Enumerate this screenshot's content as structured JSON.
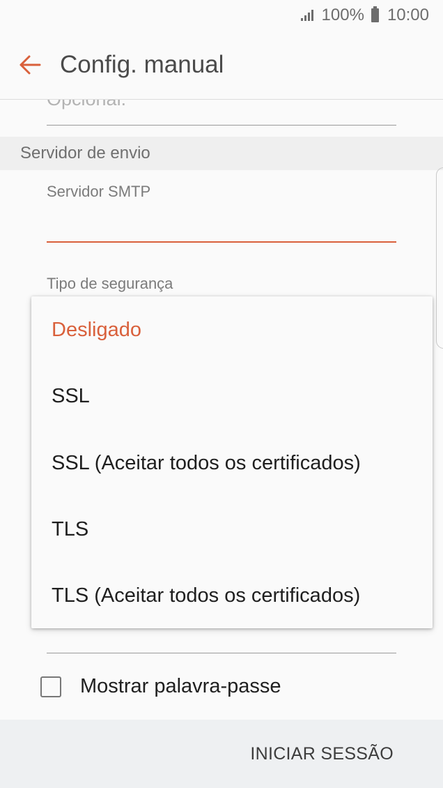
{
  "status_bar": {
    "battery": "100%",
    "time": "10:00"
  },
  "header": {
    "title": "Config. manual",
    "back_icon": "arrow-left-icon"
  },
  "form": {
    "previous_field_value": "Opcional.",
    "section_title": "Servidor de envio",
    "smtp_label": "Servidor SMTP",
    "smtp_value": "",
    "security_label": "Tipo de segurança",
    "show_password_label": "Mostrar palavra-passe",
    "show_password_checked": false
  },
  "dropdown": {
    "options": [
      "Desligado",
      "SSL",
      "SSL (Aceitar todos os certificados)",
      "TLS",
      "TLS (Aceitar todos os certificados)"
    ],
    "selected": "Desligado"
  },
  "footer": {
    "sign_in_label": "INICIAR SESSÃO"
  },
  "colors": {
    "accent": "#d9603b",
    "background": "#fafafa",
    "section_background": "#efefef",
    "footer_background": "#eef0f2"
  }
}
